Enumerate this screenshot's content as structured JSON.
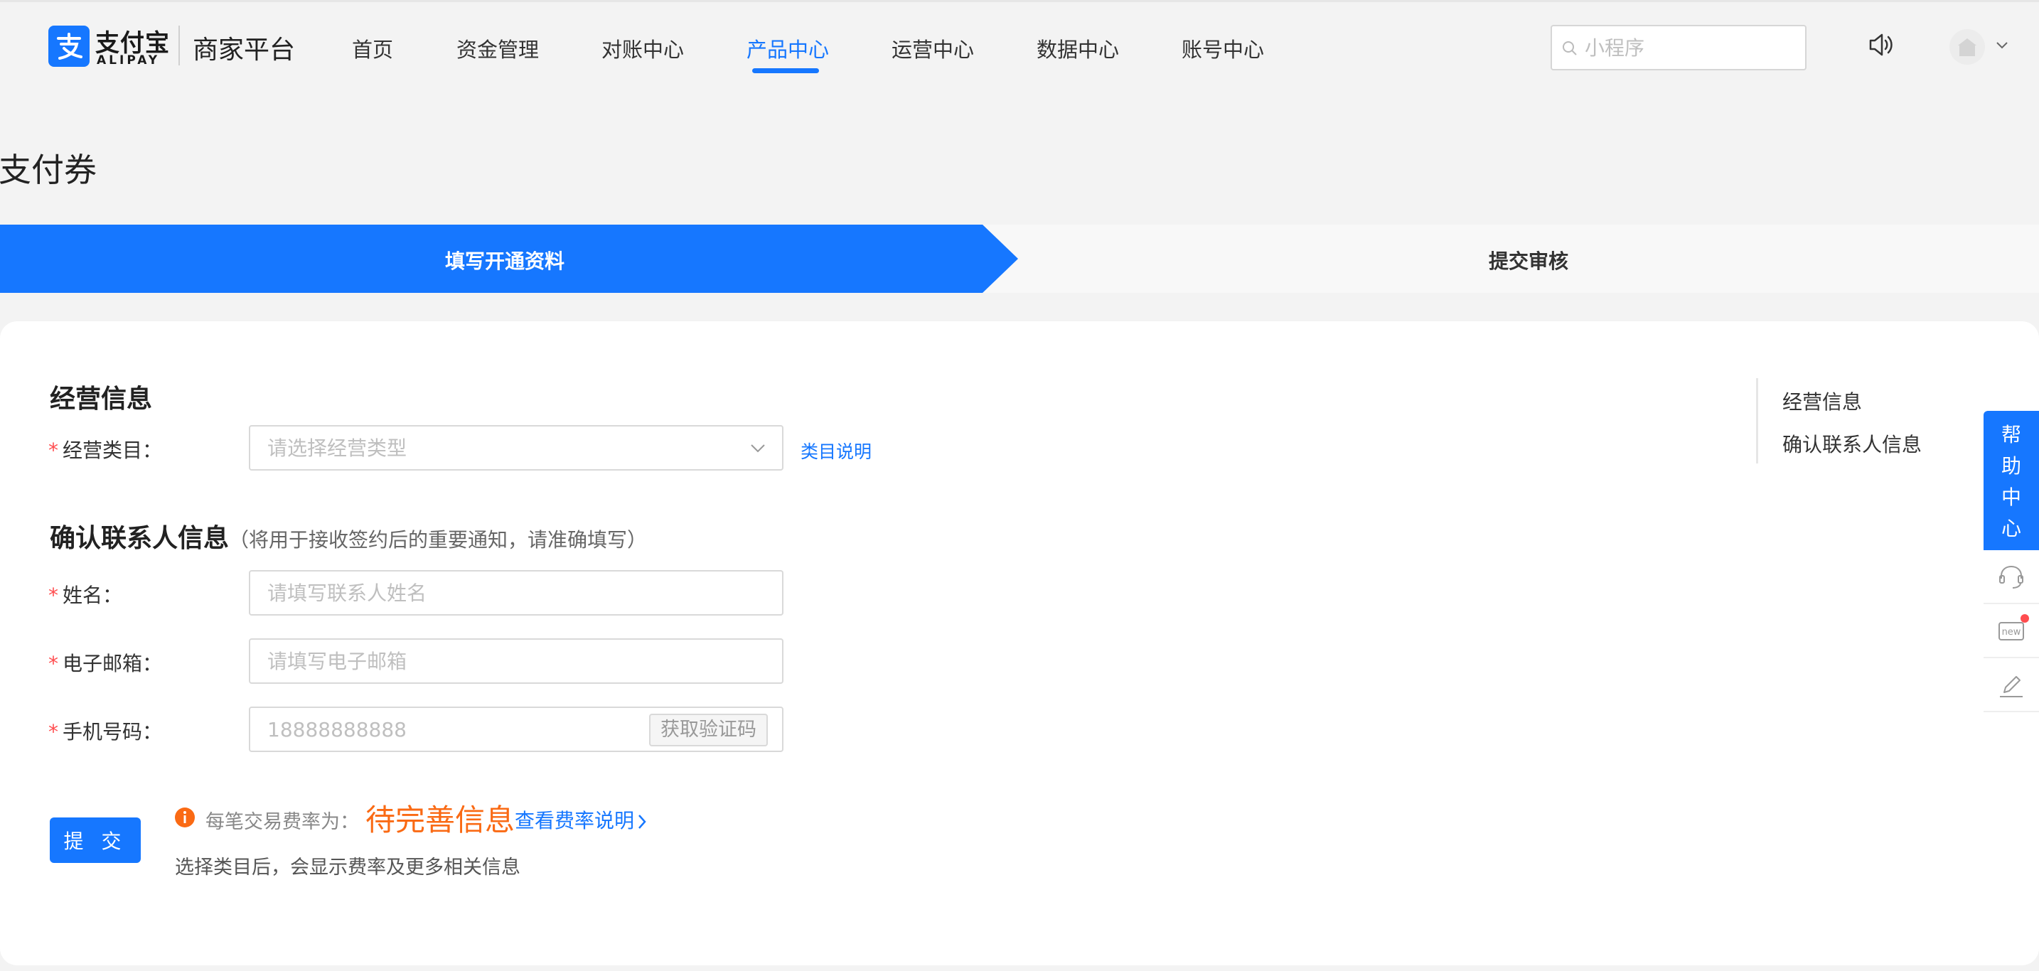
{
  "header": {
    "logo_cn": "支付宝",
    "logo_en": "ALIPAY",
    "platform_title": "商家平台",
    "nav": [
      {
        "label": "首页"
      },
      {
        "label": "资金管理"
      },
      {
        "label": "对账中心"
      },
      {
        "label": "产品中心"
      },
      {
        "label": "运营中心"
      },
      {
        "label": "数据中心"
      },
      {
        "label": "账号中心"
      }
    ],
    "active_nav": "产品中心",
    "search_placeholder": "小程序"
  },
  "page": {
    "title": "支付券"
  },
  "steps": [
    {
      "label": "填写开通资料",
      "active": true
    },
    {
      "label": "提交审核",
      "active": false
    }
  ],
  "form": {
    "business_section": {
      "title": "经营信息",
      "category_label": "经营类目：",
      "category_placeholder": "请选择经营类型",
      "category_link": "类目说明"
    },
    "contact_section": {
      "title": "确认联系人信息",
      "hint": "（将用于接收签约后的重要通知，请准确填写）",
      "name_label": "姓名：",
      "name_placeholder": "请填写联系人姓名",
      "email_label": "电子邮箱：",
      "email_placeholder": "请填写电子邮箱",
      "phone_label": "手机号码：",
      "phone_placeholder": "18888888888",
      "code_button": "获取验证码"
    },
    "required_mark": "*",
    "submit_label": "提 交",
    "fee": {
      "label": "每笔交易费率为：",
      "status": "待完善信息",
      "link": "查看费率说明",
      "note": "选择类目后，会显示费率及更多相关信息"
    }
  },
  "anchor_nav": [
    {
      "label": "经营信息"
    },
    {
      "label": "确认联系人信息"
    }
  ],
  "help_bar": {
    "main_label_chars": [
      "帮",
      "助",
      "中",
      "心"
    ],
    "tools": [
      "headset-icon",
      "new-icon",
      "edit-icon"
    ]
  },
  "colors": {
    "primary": "#1677ff",
    "warning_orange": "#fa6a14",
    "required_red": "#ff4d4f",
    "page_bg": "#f3f3f3"
  }
}
